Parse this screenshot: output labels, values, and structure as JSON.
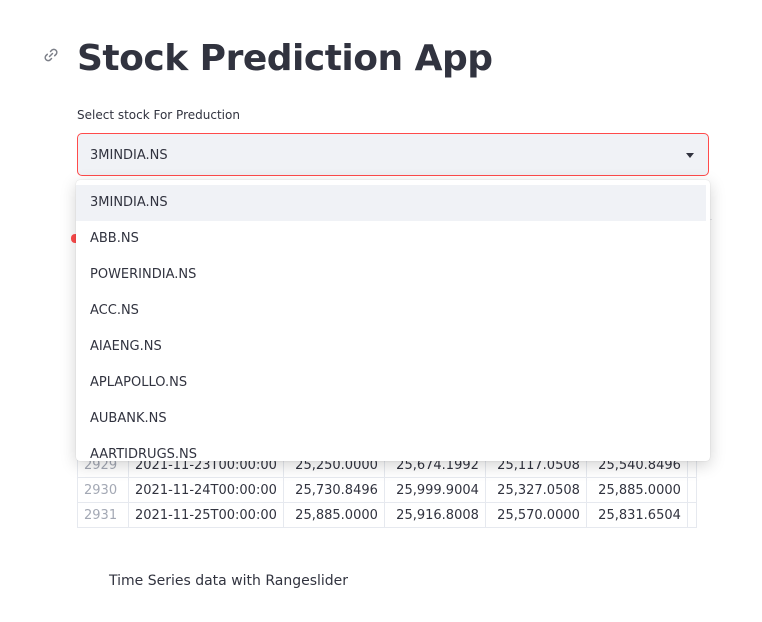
{
  "header": {
    "title": "Stock Prediction App"
  },
  "select": {
    "label": "Select stock For Preduction",
    "value": "3MINDIA.NS",
    "options": [
      "3MINDIA.NS",
      "ABB.NS",
      "POWERINDIA.NS",
      "ACC.NS",
      "AIAENG.NS",
      "APLAPOLLO.NS",
      "AUBANK.NS",
      "AARTIDRUGS.NS"
    ]
  },
  "table": {
    "rows": [
      [
        "2929",
        "2021-11-23T00:00:00",
        "25,250.0000",
        "25,674.1992",
        "25,117.0508",
        "25,540.8496"
      ],
      [
        "2930",
        "2021-11-24T00:00:00",
        "25,730.8496",
        "25,999.9004",
        "25,327.0508",
        "25,885.0000"
      ],
      [
        "2931",
        "2021-11-25T00:00:00",
        "25,885.0000",
        "25,916.8008",
        "25,570.0000",
        "25,831.6504"
      ]
    ]
  },
  "section": {
    "caption": "Time Series data with Rangeslider"
  },
  "colors": {
    "accent": "#ff4b4b",
    "select_bg": "#f0f2f6",
    "text": "#31333f"
  },
  "icons": {
    "anchor": "link-icon",
    "dropdown": "chevron-down-icon"
  }
}
